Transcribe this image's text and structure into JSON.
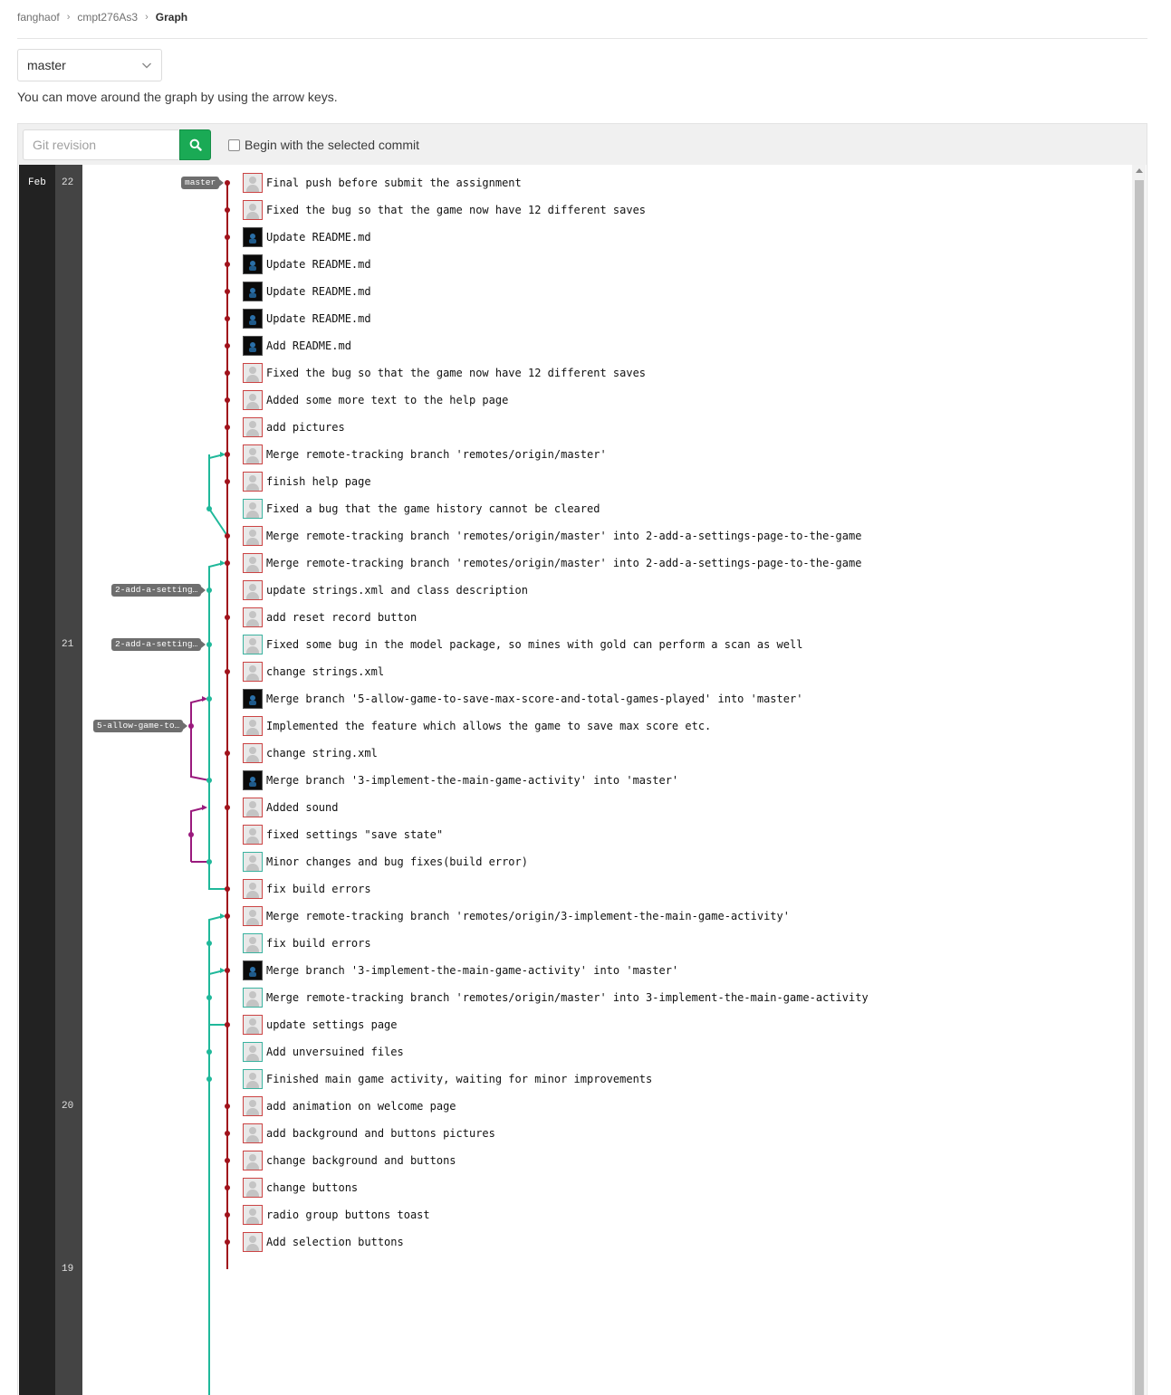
{
  "breadcrumb": {
    "user": "fanghaof",
    "project": "cmpt276As3",
    "current": "Graph"
  },
  "branch_select": {
    "value": "master"
  },
  "hint": "You can move around the graph by using the arrow keys.",
  "search": {
    "placeholder": "Git revision",
    "checkbox_label": "Begin with the selected commit"
  },
  "dates": {
    "month": "Feb",
    "days": [
      {
        "label": "22",
        "row": 0
      },
      {
        "label": "21",
        "row": 17
      },
      {
        "label": "20",
        "row": 34
      },
      {
        "label": "19",
        "row": 40
      }
    ]
  },
  "labels": [
    {
      "text": "master",
      "row": 0
    },
    {
      "text": "2-add-a-setting…",
      "row": 15
    },
    {
      "text": "2-add-a-setting…",
      "row": 17
    },
    {
      "text": "5-allow-game-to…",
      "row": 20
    }
  ],
  "colors": {
    "master": "#a0121b",
    "teal": "#1fb89a",
    "purple": "#9a1a7d",
    "accent_button": "#1aaa55"
  },
  "commits": [
    {
      "message": "Final push before submit the assignment",
      "avatar": "default"
    },
    {
      "message": "Fixed the bug so that the game now have 12 different saves",
      "avatar": "default"
    },
    {
      "message": "Update README.md",
      "avatar": "dark"
    },
    {
      "message": "Update README.md",
      "avatar": "dark"
    },
    {
      "message": "Update README.md",
      "avatar": "dark"
    },
    {
      "message": "Update README.md",
      "avatar": "dark"
    },
    {
      "message": "Add README.md",
      "avatar": "dark"
    },
    {
      "message": "Fixed the bug so that the game now have 12 different saves",
      "avatar": "default"
    },
    {
      "message": "Added some more text to the help page",
      "avatar": "default"
    },
    {
      "message": "add pictures",
      "avatar": "default"
    },
    {
      "message": "Merge remote-tracking branch 'remotes/origin/master'",
      "avatar": "default"
    },
    {
      "message": "finish help page",
      "avatar": "default"
    },
    {
      "message": "Fixed a bug that the game history cannot be cleared",
      "avatar": "teal"
    },
    {
      "message": "Merge remote-tracking branch 'remotes/origin/master' into 2-add-a-settings-page-to-the-game",
      "avatar": "default"
    },
    {
      "message": "Merge remote-tracking branch 'remotes/origin/master' into 2-add-a-settings-page-to-the-game",
      "avatar": "default"
    },
    {
      "message": "update strings.xml and class description",
      "avatar": "default"
    },
    {
      "message": "add reset record button",
      "avatar": "default"
    },
    {
      "message": "Fixed some bug in the model package, so mines with gold can perform a scan as well",
      "avatar": "teal"
    },
    {
      "message": "change strings.xml",
      "avatar": "default"
    },
    {
      "message": "Merge branch '5-allow-game-to-save-max-score-and-total-games-played' into 'master'",
      "avatar": "dark"
    },
    {
      "message": "Implemented the feature which allows the game to save max score etc.",
      "avatar": "default"
    },
    {
      "message": "change string.xml",
      "avatar": "default"
    },
    {
      "message": "Merge branch '3-implement-the-main-game-activity' into 'master'",
      "avatar": "dark"
    },
    {
      "message": "Added sound",
      "avatar": "default"
    },
    {
      "message": "fixed settings \"save state\"",
      "avatar": "default"
    },
    {
      "message": "Minor changes and bug fixes(build error)",
      "avatar": "teal"
    },
    {
      "message": "fix build errors",
      "avatar": "default"
    },
    {
      "message": "Merge remote-tracking branch 'remotes/origin/3-implement-the-main-game-activity'",
      "avatar": "default"
    },
    {
      "message": "fix build errors",
      "avatar": "teal"
    },
    {
      "message": "Merge branch '3-implement-the-main-game-activity' into 'master'",
      "avatar": "dark"
    },
    {
      "message": "Merge remote-tracking branch 'remotes/origin/master' into 3-implement-the-main-game-activity",
      "avatar": "teal"
    },
    {
      "message": "update settings page",
      "avatar": "default"
    },
    {
      "message": "Add unversuined files",
      "avatar": "teal"
    },
    {
      "message": "Finished main game activity, waiting for minor improvements",
      "avatar": "teal"
    },
    {
      "message": "add animation on welcome page",
      "avatar": "default"
    },
    {
      "message": "add background and buttons pictures",
      "avatar": "default"
    },
    {
      "message": "change background and buttons",
      "avatar": "default"
    },
    {
      "message": "change buttons",
      "avatar": "default"
    },
    {
      "message": "radio group buttons toast",
      "avatar": "default"
    },
    {
      "message": "Add selection buttons",
      "avatar": "default"
    }
  ]
}
